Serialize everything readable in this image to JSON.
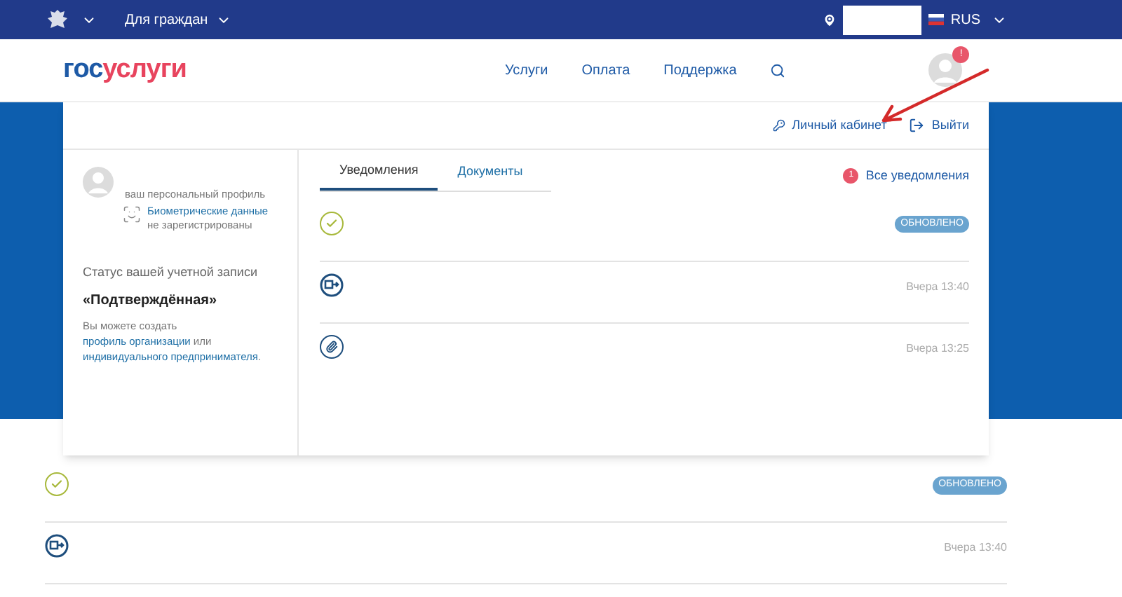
{
  "top_bar": {
    "audience_menu": "Для граждан",
    "language": "RUS"
  },
  "header": {
    "logo": {
      "first": "гос",
      "second": "услуги"
    },
    "nav": [
      "Услуги",
      "Оплата",
      "Поддержка"
    ],
    "avatar_badge": "!"
  },
  "panel": {
    "cabinet_link": "Личный кабинет",
    "logout_link": "Выйти",
    "profile": {
      "caption": "ваш персональный профиль",
      "biometrics_link": "Биометрические данные",
      "biometrics_status": "не зарегистрированы",
      "status_label": "Статус вашей учетной записи",
      "status_value": "«Подтверждённая»",
      "note": [
        {
          "text": "Вы можете создать ",
          "link": false
        },
        {
          "text": "профиль организации",
          "link": true
        },
        {
          "text": " или ",
          "link": false
        },
        {
          "text": "индивидуального предпринимателя",
          "link": true
        },
        {
          "text": ".",
          "link": false
        }
      ]
    },
    "tabs": [
      {
        "label": "Уведомления",
        "selected": true
      },
      {
        "label": "Документы",
        "selected": false
      }
    ],
    "all_notifications": {
      "count": "1",
      "label": "Все уведомления"
    },
    "notifications": [
      {
        "kind": "check",
        "badge": "ОБНОВЛЕНО"
      },
      {
        "kind": "transfer",
        "time": "Вчера 13:40"
      },
      {
        "kind": "clip",
        "time": "Вчера 13:25"
      }
    ]
  },
  "background_list": [
    {
      "kind": "check",
      "badge": "ОБНОВЛЕНО"
    },
    {
      "kind": "transfer",
      "time": "Вчера 13:40"
    }
  ]
}
